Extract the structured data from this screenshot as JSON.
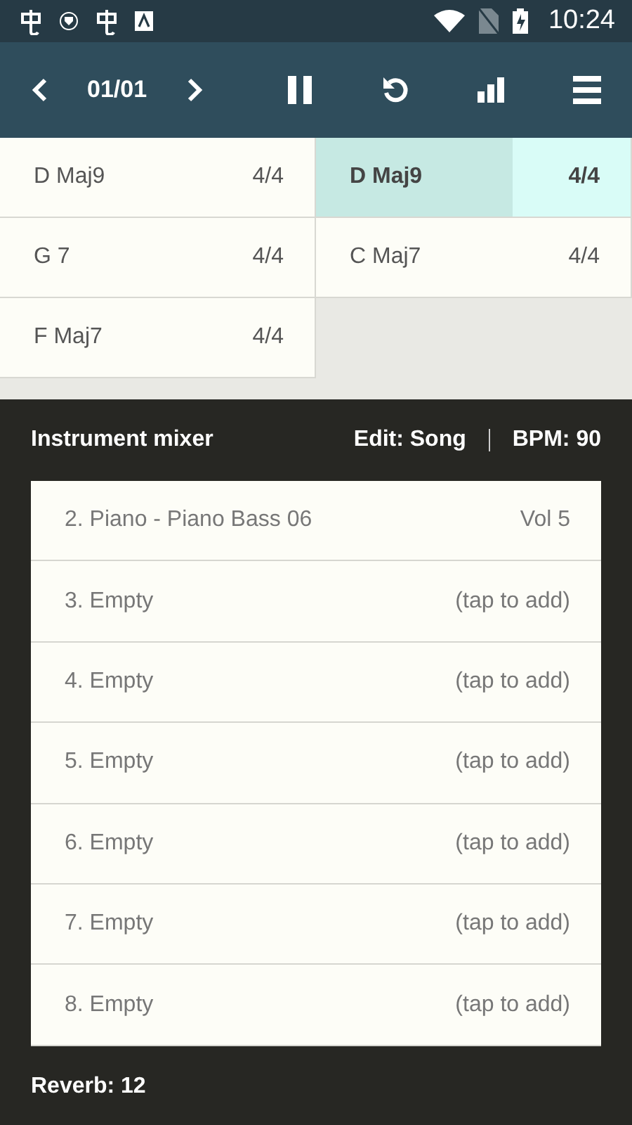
{
  "status_bar": {
    "time": "10:24"
  },
  "toolbar": {
    "position": "01/01"
  },
  "chords": [
    [
      {
        "name": "D Maj9",
        "time": "4/4",
        "selected": false
      },
      {
        "name": "G 7",
        "time": "4/4",
        "selected": false
      },
      {
        "name": "F Maj7",
        "time": "4/4",
        "selected": false
      }
    ],
    [
      {
        "name": "D Maj9",
        "time": "4/4",
        "selected": true
      },
      {
        "name": "C Maj7",
        "time": "4/4",
        "selected": false
      }
    ]
  ],
  "mixer": {
    "title": "Instrument mixer",
    "edit": "Edit: Song",
    "bpm": "BPM: 90",
    "tracks": [
      {
        "name": "2. Piano - Piano Bass 06",
        "value": "Vol 5"
      },
      {
        "name": "3. Empty",
        "value": "(tap to add)"
      },
      {
        "name": "4. Empty",
        "value": "(tap to add)"
      },
      {
        "name": "5. Empty",
        "value": "(tap to add)"
      },
      {
        "name": "6. Empty",
        "value": "(tap to add)"
      },
      {
        "name": "7. Empty",
        "value": "(tap to add)"
      },
      {
        "name": "8. Empty",
        "value": "(tap to add)"
      }
    ],
    "reverb": "Reverb: 12"
  }
}
